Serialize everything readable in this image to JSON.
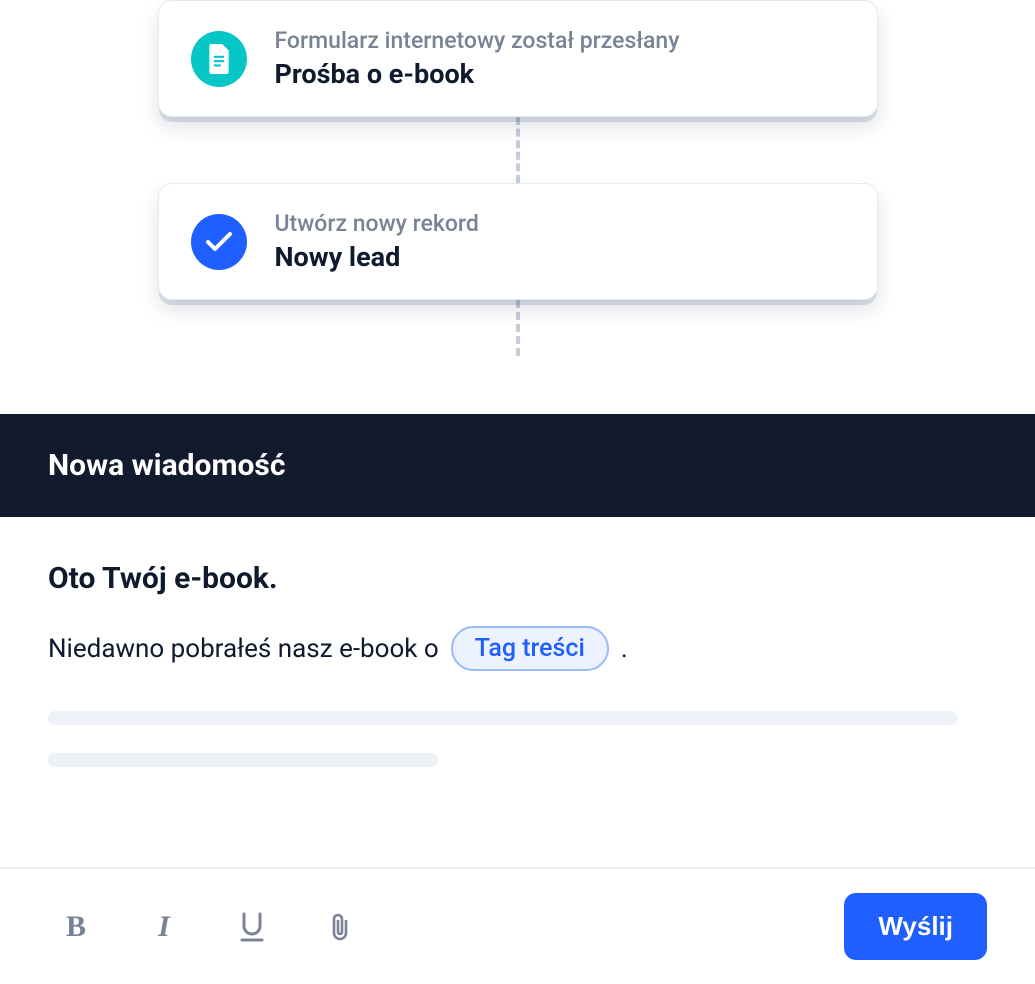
{
  "workflow": {
    "card1": {
      "subtitle": "Formularz internetowy został przesłany",
      "title": "Prośba o e-book"
    },
    "card2": {
      "subtitle": "Utwórz nowy rekord",
      "title": "Nowy lead"
    }
  },
  "compose": {
    "header": "Nowa wiadomość",
    "subject": "Oto Twój e-book.",
    "body_prefix": "Niedawno pobrałeś nasz e-book o",
    "tag_label": "Tag treści",
    "body_suffix": ".",
    "send_label": "Wyślij"
  }
}
